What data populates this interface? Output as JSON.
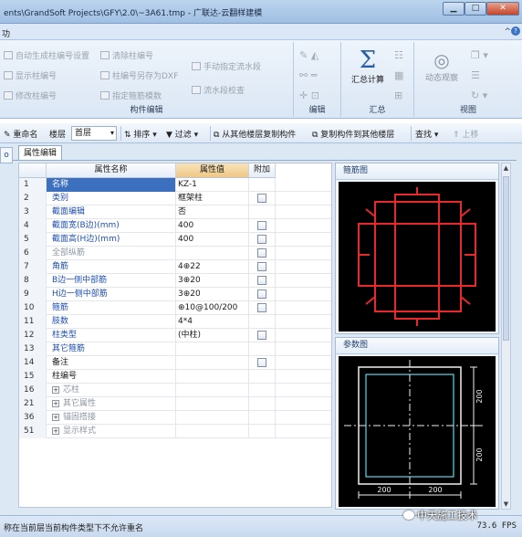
{
  "window": {
    "title": "ents\\GrandSoft Projects\\GFY\\2.0\\~3A61.tmp - 广联达-云翻样建模",
    "min_glyph": "▁",
    "max_glyph": "□",
    "close_glyph": "✕"
  },
  "menu": {
    "label": "功",
    "caret": "^",
    "help": "?"
  },
  "ribbon": {
    "column_edit": {
      "label": "构件编辑",
      "items": [
        "自动生成柱编号设置",
        "显示柱编号",
        "修改柱编号",
        "清除柱编号",
        "柱编号另存为DXF",
        "指定箍筋模数",
        "手动指定流水段",
        "流水段校查"
      ]
    },
    "edit": {
      "label": "编辑"
    },
    "summary": {
      "label": "汇总",
      "calc_label": "汇总计算",
      "calc_glyph": "Σ"
    },
    "view": {
      "label": "视图",
      "dynamic_view_label": "动态观察"
    }
  },
  "toolbar": {
    "rename": "重命名",
    "floor_label": "楼层",
    "floor_value": "首层",
    "sort": "排序",
    "filter": "过滤",
    "copy_from_floor": "从其他楼层复制构件",
    "copy_to_floor": "复制构件到其他楼层",
    "find": "查找",
    "move_up": "上移"
  },
  "panel": {
    "side_tab": "o",
    "tab_label": "属性编辑",
    "headers": {
      "name": "属性名称",
      "value": "属性值",
      "extra": "附加"
    },
    "rows": [
      {
        "num": "1",
        "name": "名称",
        "value": "KZ-1",
        "check": false
      },
      {
        "num": "2",
        "name": "类别",
        "value": "框架柱",
        "check": true
      },
      {
        "num": "3",
        "name": "截面编辑",
        "value": "否",
        "check": false
      },
      {
        "num": "4",
        "name": "截面宽(B边)(mm)",
        "value": "400",
        "check": true
      },
      {
        "num": "5",
        "name": "截面高(H边)(mm)",
        "value": "400",
        "check": true
      },
      {
        "num": "6",
        "name": "全部纵筋",
        "value": "",
        "check": true
      },
      {
        "num": "7",
        "name": "角筋",
        "value": "4⊕22",
        "check": true
      },
      {
        "num": "8",
        "name": "B边一侧中部筋",
        "value": "3⊕20",
        "check": true
      },
      {
        "num": "9",
        "name": "H边一侧中部筋",
        "value": "3⊕20",
        "check": true
      },
      {
        "num": "10",
        "name": "箍筋",
        "value": "⊕10@100/200",
        "check": true
      },
      {
        "num": "11",
        "name": "肢数",
        "value": "4*4",
        "check": false
      },
      {
        "num": "12",
        "name": "柱类型",
        "value": "(中柱)",
        "check": true
      },
      {
        "num": "13",
        "name": "其它箍筋",
        "value": "",
        "check": false
      },
      {
        "num": "14",
        "name": "备注",
        "value": "",
        "check": true
      },
      {
        "num": "15",
        "name": "柱编号",
        "value": "",
        "check": false
      },
      {
        "num": "16",
        "name": "芯柱",
        "value": "",
        "check": false,
        "group": true
      },
      {
        "num": "21",
        "name": "其它属性",
        "value": "",
        "check": false,
        "group": true
      },
      {
        "num": "36",
        "name": "锚固搭接",
        "value": "",
        "check": false,
        "group": true
      },
      {
        "num": "51",
        "name": "显示样式",
        "value": "",
        "check": false,
        "group": true
      }
    ]
  },
  "stirrup_pane": {
    "title": "箍筋图"
  },
  "param_pane": {
    "title": "参数图",
    "dims": {
      "v1": "200",
      "v2": "200",
      "h1": "200",
      "h2": "200"
    }
  },
  "status": {
    "message": "称在当前层当前构件类型下不允许重名",
    "fps": "73.6 FPS",
    "watermark": "中天施工技术"
  },
  "colors": {
    "rebar_red": "#e8282a",
    "dim_cyan": "#5ad7e6",
    "selection_blue": "#3d6fbf",
    "value_header_orange": "#eec886"
  }
}
